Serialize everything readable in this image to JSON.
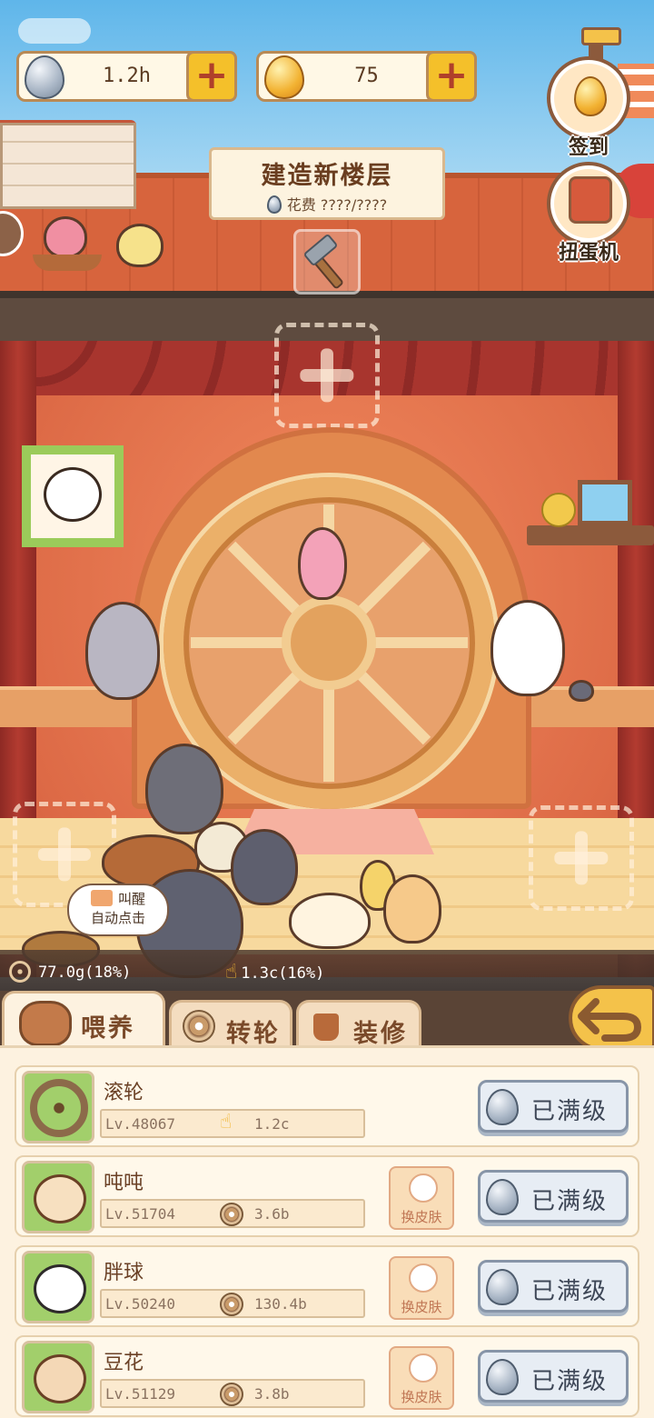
{
  "resources": {
    "egg_amount": "1.2h",
    "gold_amount": "75"
  },
  "side_buttons": {
    "signin_label": "签到",
    "gacha_label": "扭蛋机"
  },
  "build_sign": {
    "title": "建造新楼层",
    "cost_label": "花费",
    "cost_value": "????/????"
  },
  "auto_click": {
    "line1": "叫醒",
    "line2": "自动点击"
  },
  "stats": {
    "wheel_rate": "77.0g(18%)",
    "tap_rate": "1.3c(16%)"
  },
  "tabs": [
    {
      "label": "喂养",
      "active": true
    },
    {
      "label": "转轮",
      "active": false
    },
    {
      "label": "装修",
      "active": false
    }
  ],
  "items": [
    {
      "name": "滚轮",
      "level": "Lv.48067",
      "rate": "1.2c",
      "rate_icon": "tap-hand-icon",
      "has_skin": false,
      "button": "已满级"
    },
    {
      "name": "吨吨",
      "level": "Lv.51704",
      "rate": "3.6b",
      "rate_icon": "wheel-coin-icon",
      "has_skin": true,
      "skin_label": "换皮肤",
      "button": "已满级"
    },
    {
      "name": "胖球",
      "level": "Lv.50240",
      "rate": "130.4b",
      "rate_icon": "wheel-coin-icon",
      "has_skin": true,
      "skin_label": "换皮肤",
      "button": "已满级"
    },
    {
      "name": "豆花",
      "level": "Lv.51129",
      "rate": "3.8b",
      "rate_icon": "wheel-coin-icon",
      "has_skin": true,
      "skin_label": "换皮肤",
      "button": "已满级"
    }
  ]
}
